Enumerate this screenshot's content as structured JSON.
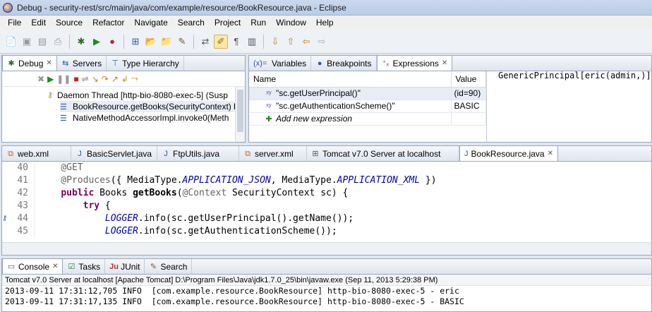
{
  "window": {
    "title": "Debug - security-rest/src/main/java/com/example/resource/BookResource.java - Eclipse"
  },
  "menu": [
    "File",
    "Edit",
    "Source",
    "Refactor",
    "Navigate",
    "Search",
    "Project",
    "Run",
    "Window",
    "Help"
  ],
  "toolbar_icons": [
    "new-icon",
    "save-icon",
    "save-all-icon",
    "print-icon",
    "debug-icon",
    "run-icon",
    "external-tools-icon",
    "new-server-icon",
    "open-type-icon",
    "open-task-icon",
    "search-icon",
    "toggle-mark-occurrences-icon",
    "highlighter-icon",
    "show-whitespace-icon",
    "block-selection-icon",
    "next-annotation-icon",
    "prev-annotation-icon",
    "back-icon",
    "forward-icon"
  ],
  "debug_view": {
    "tabs": [
      {
        "label": "Debug",
        "active": true,
        "icon": "debug-bug-icon"
      },
      {
        "label": "Servers",
        "active": false,
        "icon": "servers-icon"
      },
      {
        "label": "Type Hierarchy",
        "active": false,
        "icon": "type-hierarchy-icon"
      }
    ],
    "rows": [
      {
        "label": "Daemon Thread [http-bio-8080-exec-5] (Susp",
        "kind": "thread"
      },
      {
        "label": "BookResource.getBooks(SecurityContext) li",
        "kind": "frame",
        "selected": true
      },
      {
        "label": "NativeMethodAccessorImpl.invoke0(Meth",
        "kind": "frame"
      }
    ]
  },
  "expressions_view": {
    "tabs": [
      {
        "label": "Variables",
        "active": false,
        "icon": "variables-icon"
      },
      {
        "label": "Breakpoints",
        "active": false,
        "icon": "breakpoints-icon"
      },
      {
        "label": "Expressions",
        "active": true,
        "icon": "expressions-icon"
      }
    ],
    "columns": [
      "Name",
      "Value"
    ],
    "rows": [
      {
        "name": "\"sc.getUserPrincipal()\"",
        "value": "(id=90)",
        "selected": true
      },
      {
        "name": "\"sc.getAuthenticationScheme()\"",
        "value": "BASIC"
      }
    ],
    "add_label": "Add new expression",
    "detail": "GenericPrincipal[eric(admin,)]"
  },
  "editor": {
    "tabs": [
      {
        "label": "web.xml",
        "active": false
      },
      {
        "label": "BasicServlet.java",
        "active": false
      },
      {
        "label": "FtpUtils.java",
        "active": false
      },
      {
        "label": "server.xml",
        "active": false
      },
      {
        "label": "Tomcat v7.0 Server at localhost",
        "active": false
      },
      {
        "label": "BookResource.java",
        "active": true
      }
    ],
    "lines": [
      {
        "num": "40",
        "text": "    @GET"
      },
      {
        "num": "41",
        "text": "    @Produces({ MediaType.APPLICATION_JSON, MediaType.APPLICATION_XML })"
      },
      {
        "num": "42",
        "text": "    public Books getBooks(@Context SecurityContext sc) {"
      },
      {
        "num": "43",
        "text": "        try {"
      },
      {
        "num": "44",
        "text": "            LOGGER.info(sc.getUserPrincipal().getName());"
      },
      {
        "num": "45",
        "text": "            LOGGER.info(sc.getAuthenticationScheme());"
      }
    ]
  },
  "console": {
    "tabs": [
      {
        "label": "Console",
        "active": true
      },
      {
        "label": "Tasks",
        "active": false
      },
      {
        "label": "JUnit",
        "active": false
      },
      {
        "label": "Search",
        "active": false
      }
    ],
    "launch_info": "Tomcat v7.0 Server at localhost [Apache Tomcat] D:\\Program Files\\Java\\jdk1.7.0_25\\bin\\javaw.exe (Sep 11, 2013 5:29:38 PM)",
    "output": [
      "2013-09-11 17:31:12,705 INFO  [com.example.resource.BookResource] http-bio-8080-exec-5 - eric",
      "2013-09-11 17:31:17,135 INFO  [com.example.resource.BookResource] http-bio-8080-exec-5 - BASIC"
    ]
  }
}
